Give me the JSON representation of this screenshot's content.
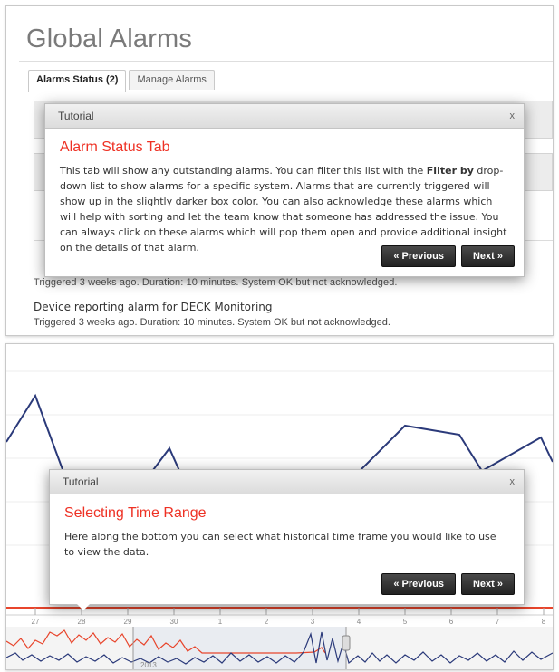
{
  "top_screen": {
    "page_title": "Global Alarms",
    "tabs": [
      {
        "label": "Alarms Status (2)",
        "active": true
      },
      {
        "label": "Manage Alarms",
        "active": false
      }
    ],
    "partial_row_text": "Triggered 3 weeks ago. Duration: 10 minutes. System OK but not acknowledged.",
    "alarm_items": [
      {
        "title": "Device reporting alarm for DECK Monitoring",
        "detail": "Triggered 3 weeks ago. Duration: 10 minutes. System OK but not acknowledged."
      }
    ],
    "tutorial": {
      "header": "Tutorial",
      "close": "x",
      "heading": "Alarm Status Tab",
      "body_part1": "This tab will show any outstanding alarms. You can filter this list with the ",
      "body_bold": "Filter by",
      "body_part2": " drop-down list to show alarms for a specific system. Alarms that are currently triggered will show up in the slightly darker box color. You can also acknowledge these alarms which will help with sorting and let the team know that someone has addressed the issue. You can always click on these alarms which will pop them open and provide additional insight on the details of that alarm.",
      "previous": "« Previous",
      "next": "Next »"
    }
  },
  "bottom_screen": {
    "tutorial": {
      "header": "Tutorial",
      "close": "x",
      "heading": "Selecting Time Range",
      "body": "Here along the bottom you can select what historical time frame you would like to use to view the data.",
      "previous": "« Previous",
      "next": "Next »"
    },
    "timeline_labels": [
      "27",
      "28",
      "29",
      "30",
      "1",
      "2",
      "3",
      "4",
      "5",
      "6",
      "7",
      "8"
    ],
    "navigator_label": "2013",
    "colors": {
      "main_line": "#2b3a7a",
      "red_line": "#e8452c",
      "accent_red": "#ee3124"
    }
  }
}
